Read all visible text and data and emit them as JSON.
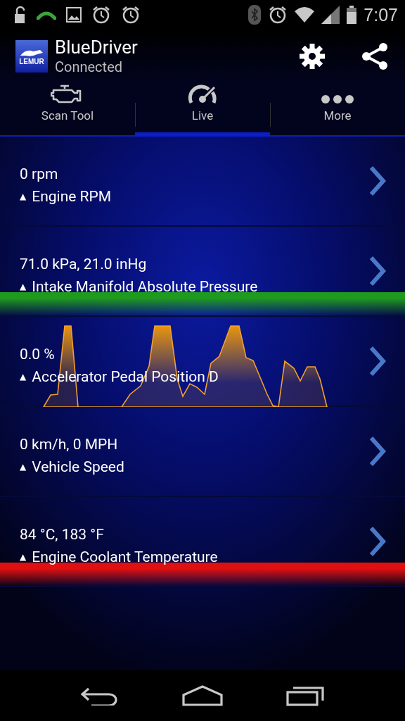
{
  "status_bar": {
    "time": "7:07"
  },
  "app_bar": {
    "title": "BlueDriver",
    "subtitle": "Connected",
    "logo_text": "LEMUR"
  },
  "tabs": [
    {
      "label": "Scan Tool",
      "kind": "engine",
      "selected": false
    },
    {
      "label": "Live",
      "kind": "gauge",
      "selected": true
    },
    {
      "label": "More",
      "kind": "dots",
      "selected": false
    }
  ],
  "readings": [
    {
      "value": "0 rpm",
      "arrow": "▲",
      "name": "Engine RPM",
      "graph": false
    },
    {
      "value": "71.0 kPa, 21.0 inHg",
      "arrow": "▲",
      "name": "Intake Manifold Absolute Pressure",
      "graph": false,
      "band": {
        "color": "#1f9a1f"
      }
    },
    {
      "value": "0.0 %",
      "arrow": "▲",
      "name": "Accelerator Pedal Position D",
      "graph": true
    },
    {
      "value": "0 km/h, 0 MPH",
      "arrow": "▲",
      "name": "Vehicle Speed",
      "graph": false
    },
    {
      "value": "84 °C, 183 °F",
      "arrow": "▲",
      "name": "Engine Coolant Temperature",
      "graph": false,
      "band": {
        "color": "#e01010"
      }
    }
  ]
}
